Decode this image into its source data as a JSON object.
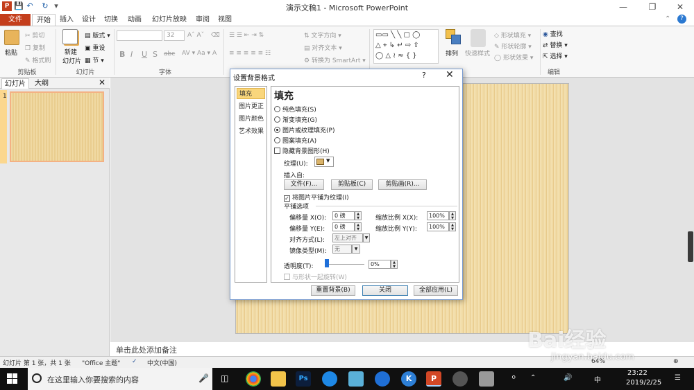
{
  "window": {
    "title": "演示文稿1 - Microsoft PowerPoint",
    "app_icon": "P"
  },
  "tabs": [
    "文件",
    "开始",
    "插入",
    "设计",
    "切换",
    "动画",
    "幻灯片放映",
    "审阅",
    "视图"
  ],
  "ribbon": {
    "clipboard": {
      "paste": "粘贴",
      "cut": "剪切",
      "copy": "复制",
      "format_painter": "格式刷",
      "label": "剪贴板"
    },
    "slides": {
      "new_slide": "新建\n幻灯片",
      "new_slide_1": "新建",
      "new_slide_2": "幻灯片",
      "layout": "版式",
      "reset": "重设",
      "section": "节",
      "label": "幻灯片"
    },
    "font": {
      "size": "32",
      "label": "字体",
      "bold": "B",
      "italic": "I",
      "underline": "U",
      "strike": "S",
      "shadow": "abc"
    },
    "paragraph": {
      "text_direction": "文字方向",
      "align_text": "对齐文本",
      "smartart": "转换为 SmartArt",
      "label": "段落"
    },
    "drawing": {
      "arrange": "排列",
      "quick_styles": "快速样式",
      "shape_fill": "形状填充",
      "shape_outline": "形状轮廓",
      "shape_effects": "形状效果",
      "label": "绘图"
    },
    "editing": {
      "find": "查找",
      "replace": "替换",
      "select": "选择",
      "label": "编辑"
    }
  },
  "left_panel": {
    "tabs": [
      "幻灯片",
      "大纲"
    ],
    "slide_number": "1"
  },
  "notes": {
    "placeholder": "单击此处添加备注"
  },
  "statusbar": {
    "slide_info": "幻灯片 第 1 张，共 1 张",
    "theme": "\"Office 主题\"",
    "language": "中文(中国)",
    "zoom": "64%"
  },
  "dialog": {
    "title": "设置背景格式",
    "help": "?",
    "nav": [
      "填充",
      "图片更正",
      "图片颜色",
      "艺术效果"
    ],
    "heading": "填充",
    "fill_options": [
      {
        "label": "纯色填充(S)",
        "selected": false
      },
      {
        "label": "渐变填充(G)",
        "selected": false
      },
      {
        "label": "图片或纹理填充(P)",
        "selected": true
      },
      {
        "label": "图案填充(A)",
        "selected": false
      }
    ],
    "hide_bg": "隐藏背景图形(H)",
    "texture_label": "纹理(U):",
    "insert_from": "插入自:",
    "file_btn": "文件(F)...",
    "clipboard_btn": "剪贴板(C)",
    "clipart_btn": "剪贴画(R)...",
    "tile_check": "将图片平铺为纹理(I)",
    "tile_options": "平铺选项",
    "offset_x_label": "偏移量 X(O):",
    "offset_x": "0 磅",
    "offset_y_label": "偏移量 Y(E):",
    "offset_y": "0 磅",
    "scale_x_label": "缩放比例 X(X):",
    "scale_x": "100%",
    "scale_y_label": "缩放比例 Y(Y):",
    "scale_y": "100%",
    "align_label": "对齐方式(L):",
    "align_value": "左上对齐",
    "mirror_label": "镜像类型(M):",
    "mirror_value": "无",
    "transparency_label": "透明度(T):",
    "transparency_value": "0%",
    "transparency": 0,
    "rotate_with_shape": "与形状一起旋转(W)",
    "reset_btn": "重置背景(B)",
    "close_btn": "关闭",
    "apply_all_btn": "全部应用(L)"
  },
  "taskbar": {
    "search_placeholder": "在这里输入你要搜索的内容",
    "time": "23:22",
    "date": "2019/2/25",
    "ime": "中",
    "app_ps": "Ps",
    "app_k": "K",
    "app_p": "P"
  },
  "watermark": {
    "text": "Bai经验",
    "sub": "jingyan.baidu.com"
  },
  "colors": {
    "file_tab": "#c43e1c",
    "accent": "#2b579a",
    "nav_selected": "#f9d67c",
    "thumb_border": "#f4b183"
  }
}
